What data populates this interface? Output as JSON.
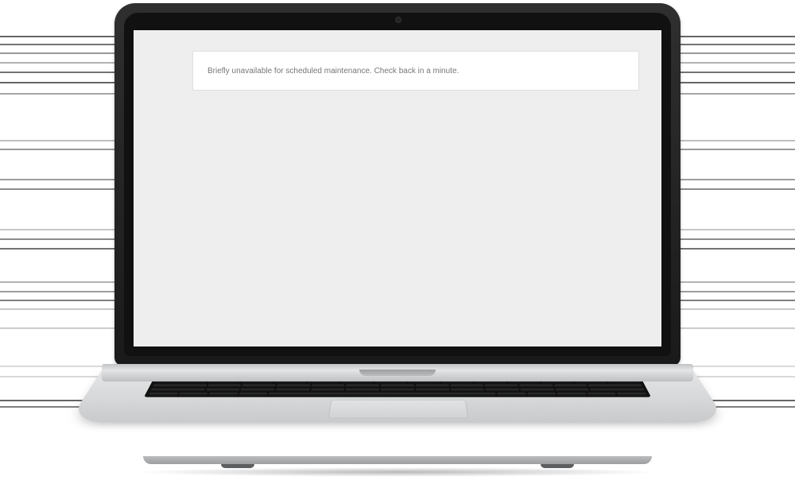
{
  "screen": {
    "maintenance_message": "Briefly unavailable for scheduled maintenance. Check back in a minute."
  }
}
